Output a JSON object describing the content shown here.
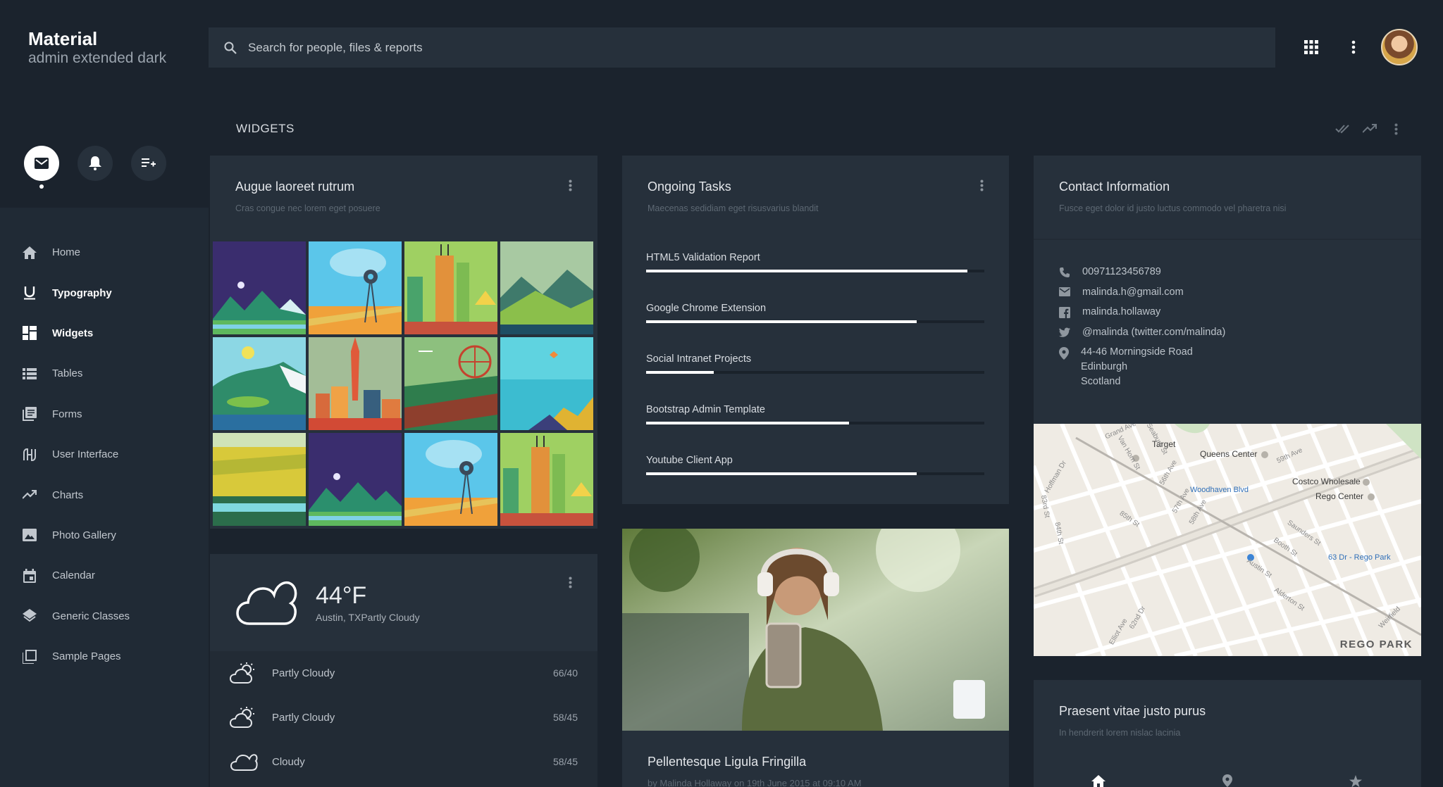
{
  "brand": {
    "title": "Material",
    "subtitle": "admin extended dark"
  },
  "search": {
    "placeholder": "Search for people, files & reports"
  },
  "sidebar": {
    "quick_actions": [
      "mail-icon",
      "bell-icon",
      "playlist-add-icon"
    ],
    "items": [
      {
        "label": "Home",
        "icon": "home-icon",
        "bold": false
      },
      {
        "label": "Typography",
        "icon": "underline-icon",
        "bold": true
      },
      {
        "label": "Widgets",
        "icon": "dashboard-icon",
        "bold": true
      },
      {
        "label": "Tables",
        "icon": "list-icon",
        "bold": false
      },
      {
        "label": "Forms",
        "icon": "library-books-icon",
        "bold": false
      },
      {
        "label": "User Interface",
        "icon": "ui-icon",
        "bold": false
      },
      {
        "label": "Charts",
        "icon": "trending-up-icon",
        "bold": false
      },
      {
        "label": "Photo Gallery",
        "icon": "image-icon",
        "bold": false
      },
      {
        "label": "Calendar",
        "icon": "calendar-icon",
        "bold": false
      },
      {
        "label": "Generic Classes",
        "icon": "layers-icon",
        "bold": false
      },
      {
        "label": "Sample Pages",
        "icon": "filter-none-icon",
        "bold": false
      }
    ]
  },
  "section": {
    "title": "WIDGETS"
  },
  "gallery_card": {
    "title": "Augue laoreet rutrum",
    "subtitle": "Cras congue nec lorem eget posuere"
  },
  "weather": {
    "temp": "44°F",
    "location": "Austin, TXPartly Cloudy",
    "forecast": [
      {
        "condition": "Partly Cloudy",
        "range": "66/40",
        "icon": "partly-cloudy-icon"
      },
      {
        "condition": "Partly Cloudy",
        "range": "58/45",
        "icon": "partly-cloudy-icon"
      },
      {
        "condition": "Cloudy",
        "range": "58/45",
        "icon": "cloudy-icon"
      }
    ]
  },
  "tasks": {
    "title": "Ongoing Tasks",
    "subtitle": "Maecenas sedidiam eget risusvarius blandit",
    "items": [
      {
        "label": "HTML5 Validation Report",
        "progress": 0.95
      },
      {
        "label": "Google Chrome Extension",
        "progress": 0.8
      },
      {
        "label": "Social Intranet Projects",
        "progress": 0.2
      },
      {
        "label": "Bootstrap Admin Template",
        "progress": 0.6
      },
      {
        "label": "Youtube Client App",
        "progress": 0.8
      }
    ]
  },
  "contact": {
    "title": "Contact Information",
    "subtitle": "Fusce eget dolor id justo luctus commodo vel pharetra nisi",
    "phone": "00971123456789",
    "email": "malinda.h@gmail.com",
    "facebook": "malinda.hollaway",
    "twitter": "@malinda (twitter.com/malinda)",
    "address_line1": "44-46 Morningside Road",
    "address_line2": "Edinburgh",
    "address_line3": "Scotland"
  },
  "map": {
    "area_label": "REGO PARK",
    "places": [
      "Target",
      "Queens Center",
      "Costco Wholesale",
      "Rego Center",
      "Woodhaven Blvd",
      "63 Dr - Rego Park"
    ],
    "streets": [
      "Grand Ave",
      "Van Horn St",
      "Hoffman Dr",
      "Seabury St",
      "56th Ave",
      "57th Ave",
      "59th Ave",
      "58th Ave",
      "Saunders St",
      "Booth St",
      "Austin St",
      "Alderton St",
      "Elliot Ave",
      "83rd St",
      "84th St",
      "85th St",
      "62nd Dr",
      "Weirfield"
    ]
  },
  "blog": {
    "title": "Pellentesque Ligula Fringilla",
    "meta": "by Malinda Hollaway on 19th June 2015 at 09:10 AM"
  },
  "praesent": {
    "title": "Praesent vitae justo purus",
    "subtitle": "In hendrerit lorem nislac lacinia"
  }
}
